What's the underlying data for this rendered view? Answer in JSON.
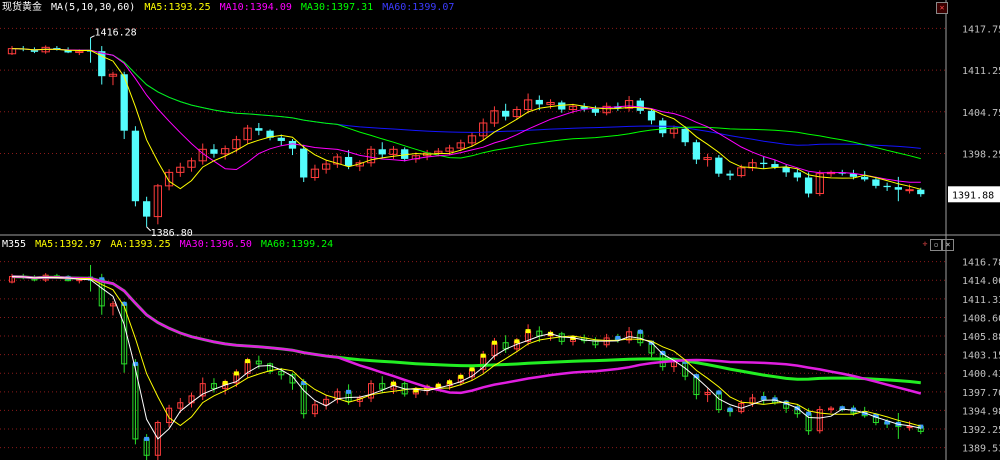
{
  "colors": {
    "background": "#000000",
    "up": "#ff3c3c",
    "down": "#54fcfc",
    "ma5": "#ffff00",
    "ma10": "#ff00ff",
    "ma30": "#00ff00",
    "ma60": "#1414ff",
    "grid": "#8b1a1a",
    "axis_text": "#c0c0c0"
  },
  "top_panel": {
    "symbol": "现货黄金",
    "ma_label": "MA(5,10,30,60)",
    "ma5": "MA5:1393.25",
    "ma10": "MA10:1394.09",
    "ma30": "MA30:1397.31",
    "ma60": "MA60:1399.07",
    "high_marker": "1416.28",
    "low_marker": "1386.80",
    "last_price": "1391.88"
  },
  "bottom_panel": {
    "indicator": "M355",
    "ma5": "MA5:1392.97",
    "aa": "AA:1393.25",
    "ma30": "MA30:1396.50",
    "ma60": "MA60:1399.24"
  },
  "chart_data": [
    {
      "type": "candlestick",
      "title": "现货黄金",
      "y_ticks": [
        1417.75,
        1411.25,
        1404.75,
        1398.25
      ],
      "ylim": [
        1386.0,
        1420.0
      ],
      "candles": [
        [
          1413.8,
          1415.0,
          1413.6,
          1414.6
        ],
        [
          1414.6,
          1415.0,
          1414.2,
          1414.5
        ],
        [
          1414.5,
          1414.8,
          1413.9,
          1414.1
        ],
        [
          1414.1,
          1415.1,
          1413.8,
          1414.8
        ],
        [
          1414.7,
          1415.0,
          1414.3,
          1414.4
        ],
        [
          1414.4,
          1414.8,
          1413.9,
          1414.0
        ],
        [
          1414.0,
          1414.5,
          1413.6,
          1414.2
        ],
        [
          1414.3,
          1416.3,
          1412.4,
          1414.2
        ],
        [
          1414.2,
          1415.0,
          1409.0,
          1410.3
        ],
        [
          1410.3,
          1411.0,
          1408.9,
          1410.6
        ],
        [
          1410.6,
          1411.0,
          1400.5,
          1401.8
        ],
        [
          1401.8,
          1402.5,
          1390.0,
          1390.8
        ],
        [
          1390.8,
          1391.5,
          1386.8,
          1388.4
        ],
        [
          1388.4,
          1393.5,
          1387.2,
          1393.2
        ],
        [
          1393.2,
          1395.8,
          1392.5,
          1395.3
        ],
        [
          1395.3,
          1396.8,
          1394.6,
          1396.1
        ],
        [
          1396.1,
          1397.6,
          1395.4,
          1397.1
        ],
        [
          1397.1,
          1399.8,
          1396.5,
          1398.9
        ],
        [
          1398.9,
          1399.7,
          1397.6,
          1398.2
        ],
        [
          1398.2,
          1399.5,
          1397.3,
          1399.0
        ],
        [
          1399.0,
          1401.0,
          1398.4,
          1400.4
        ],
        [
          1400.4,
          1402.7,
          1399.8,
          1402.2
        ],
        [
          1402.2,
          1403.0,
          1401.1,
          1401.8
        ],
        [
          1401.8,
          1402.0,
          1400.3,
          1400.7
        ],
        [
          1400.7,
          1401.2,
          1399.5,
          1400.2
        ],
        [
          1400.2,
          1400.5,
          1398.0,
          1399.0
        ],
        [
          1399.0,
          1399.6,
          1393.8,
          1394.5
        ],
        [
          1394.5,
          1396.5,
          1394.0,
          1395.8
        ],
        [
          1395.8,
          1397.2,
          1395.1,
          1396.6
        ],
        [
          1396.6,
          1398.2,
          1396.0,
          1397.7
        ],
        [
          1397.7,
          1398.8,
          1395.8,
          1396.3
        ],
        [
          1396.3,
          1397.2,
          1395.5,
          1396.8
        ],
        [
          1396.8,
          1399.4,
          1396.2,
          1398.9
        ],
        [
          1398.9,
          1400.0,
          1397.5,
          1398.1
        ],
        [
          1398.1,
          1399.4,
          1397.4,
          1398.9
        ],
        [
          1398.9,
          1399.2,
          1397.0,
          1397.4
        ],
        [
          1397.4,
          1398.4,
          1396.8,
          1397.9
        ],
        [
          1397.9,
          1398.8,
          1397.2,
          1398.3
        ],
        [
          1398.3,
          1399.1,
          1397.8,
          1398.6
        ],
        [
          1398.6,
          1399.6,
          1398.0,
          1399.1
        ],
        [
          1399.1,
          1400.4,
          1398.6,
          1399.9
        ],
        [
          1399.9,
          1401.6,
          1399.3,
          1401.0
        ],
        [
          1401.0,
          1403.7,
          1400.4,
          1403.0
        ],
        [
          1403.0,
          1405.6,
          1402.4,
          1404.9
        ],
        [
          1404.9,
          1406.0,
          1403.4,
          1404.0
        ],
        [
          1404.0,
          1405.6,
          1403.5,
          1405.1
        ],
        [
          1405.1,
          1407.6,
          1404.5,
          1406.6
        ],
        [
          1406.6,
          1407.3,
          1405.0,
          1405.9
        ],
        [
          1405.9,
          1406.7,
          1405.2,
          1406.2
        ],
        [
          1406.2,
          1406.5,
          1404.6,
          1405.1
        ],
        [
          1405.1,
          1406.0,
          1404.5,
          1405.6
        ],
        [
          1405.6,
          1406.1,
          1404.8,
          1405.2
        ],
        [
          1405.2,
          1405.7,
          1404.1,
          1404.6
        ],
        [
          1404.6,
          1406.2,
          1404.2,
          1405.6
        ],
        [
          1405.6,
          1406.2,
          1404.9,
          1405.3
        ],
        [
          1405.3,
          1407.2,
          1404.8,
          1406.5
        ],
        [
          1406.5,
          1406.9,
          1404.4,
          1404.9
        ],
        [
          1404.9,
          1405.2,
          1402.8,
          1403.4
        ],
        [
          1403.4,
          1403.8,
          1400.8,
          1401.4
        ],
        [
          1401.4,
          1402.6,
          1400.6,
          1402.1
        ],
        [
          1402.1,
          1402.5,
          1399.4,
          1400.0
        ],
        [
          1400.0,
          1400.4,
          1396.6,
          1397.3
        ],
        [
          1397.3,
          1398.2,
          1396.2,
          1397.6
        ],
        [
          1397.6,
          1398.0,
          1394.6,
          1395.1
        ],
        [
          1395.1,
          1395.6,
          1394.1,
          1394.8
        ],
        [
          1394.8,
          1396.5,
          1394.5,
          1396.0
        ],
        [
          1396.0,
          1397.4,
          1395.5,
          1396.8
        ],
        [
          1396.8,
          1397.7,
          1395.9,
          1396.6
        ],
        [
          1396.6,
          1397.2,
          1395.8,
          1396.1
        ],
        [
          1396.1,
          1396.5,
          1394.6,
          1395.3
        ],
        [
          1395.3,
          1395.8,
          1393.9,
          1394.5
        ],
        [
          1394.5,
          1395.3,
          1391.4,
          1392.0
        ],
        [
          1392.0,
          1395.6,
          1391.6,
          1395.1
        ],
        [
          1395.1,
          1395.6,
          1394.6,
          1395.3
        ],
        [
          1395.3,
          1395.7,
          1394.8,
          1395.1
        ],
        [
          1395.1,
          1395.7,
          1394.2,
          1394.6
        ],
        [
          1394.6,
          1395.5,
          1393.9,
          1394.2
        ],
        [
          1394.2,
          1394.6,
          1392.8,
          1393.2
        ],
        [
          1393.2,
          1393.7,
          1392.4,
          1393.0
        ],
        [
          1393.0,
          1394.6,
          1390.8,
          1392.6
        ],
        [
          1392.6,
          1393.4,
          1392.0,
          1392.6
        ],
        [
          1392.6,
          1392.9,
          1391.5,
          1391.9
        ]
      ]
    },
    {
      "type": "line",
      "title": "M355",
      "y_ticks": [
        1416.78,
        1414.06,
        1411.33,
        1408.6,
        1405.88,
        1403.15,
        1400.43,
        1397.7,
        1394.98,
        1392.25,
        1389.53
      ],
      "ylim": [
        1388.0,
        1418.2
      ]
    }
  ]
}
